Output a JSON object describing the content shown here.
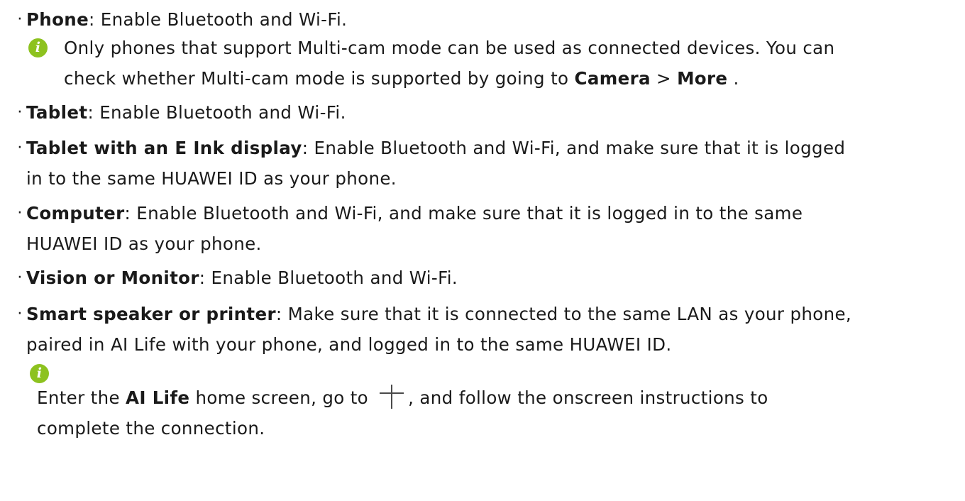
{
  "colors": {
    "text": "#1a1a1a",
    "note_icon": "#8dc21f",
    "background": "#ffffff"
  },
  "bullet": "·",
  "items": [
    {
      "label": "Phone",
      "text": ": Enable Bluetooth and Wi-Fi."
    },
    {
      "label": "Tablet",
      "text": ": Enable Bluetooth and Wi-Fi."
    },
    {
      "label": "Tablet with an E Ink display",
      "text": ": Enable Bluetooth and Wi-Fi, and make sure that it is logged",
      "text_line2": "in to the same HUAWEI ID as your phone."
    },
    {
      "label": "Computer",
      "text": ": Enable Bluetooth and Wi-Fi, and make sure that it is logged in to the same",
      "text_line2": "HUAWEI ID as your phone."
    },
    {
      "label": "Vision or Monitor",
      "text": ": Enable Bluetooth and Wi-Fi."
    },
    {
      "label": "Smart speaker or printer",
      "text": ": Make sure that it is connected to the same LAN as your phone,",
      "text_line2": "paired in AI Life with your phone, and logged in to the same HUAWEI ID."
    }
  ],
  "note1": {
    "icon": "info-icon",
    "line1": "Only phones that support Multi-cam mode can be used as connected devices. You can",
    "line2_before": "check whether Multi-cam mode is supported by going to ",
    "camera": "Camera",
    "separator": " > ",
    "more": "More",
    "line2_after": " ."
  },
  "note2": {
    "icon": "info-icon",
    "before": "Enter the ",
    "ai_life": "AI Life",
    "middle": " home screen, go to ",
    "plus_icon": "plus-icon",
    "after": ", and follow the onscreen instructions to",
    "line2": "complete the connection."
  }
}
